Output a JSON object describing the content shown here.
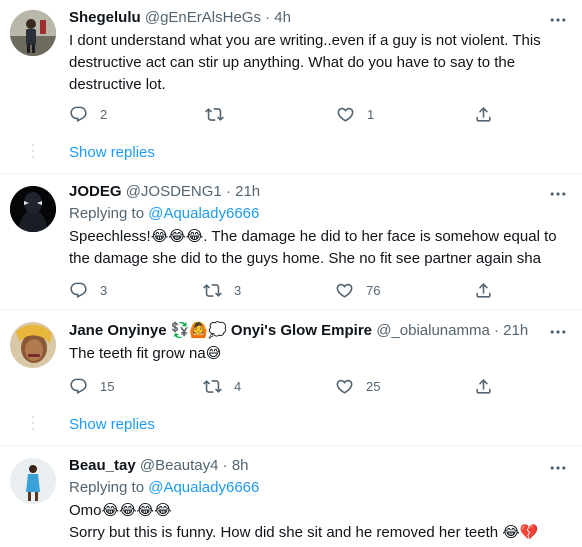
{
  "tweets": [
    {
      "name": "Shegelulu",
      "handle": "@gEnErAlsHeGs",
      "time": "· 4h",
      "text": "I dont understand what you are writing..even if a guy is not violent. This destructive act can stir up anything. What do you have to say to the destructive lot.",
      "replies": "2",
      "retweets": "",
      "likes": "1"
    },
    {
      "name": "JODEG",
      "handle": "@JOSDENG1",
      "time": "· 21h",
      "replying_label": "Replying to",
      "replying_handle": "@Aqualady6666",
      "text": "Speechless!😂😂😂.  The damage he did to her face is somehow equal to the damage she did to the guys home. She no fit see partner again sha",
      "replies": "3",
      "retweets": "3",
      "likes": "76"
    },
    {
      "name": "Jane Onyinye 💱🙆💭 Onyi's Glow Empire",
      "handle": "@_obialunamma",
      "time": "· 21h",
      "text": "The teeth fit grow na😅",
      "replies": "15",
      "retweets": "4",
      "likes": "25"
    },
    {
      "name": "Beau_tay",
      "handle": "@Beautay4",
      "time": "· 8h",
      "replying_label": "Replying to",
      "replying_handle": "@Aqualady6666",
      "text_line1": "Omo😂😂😂😂",
      "text_line2": "Sorry but this is funny. How did she sit and he removed her teeth 😂💔"
    }
  ],
  "show_replies": "Show replies",
  "colors": {
    "accent": "#1d9bf0",
    "muted": "#536471",
    "divider": "#eff3f4"
  },
  "icons": [
    "reply-icon",
    "retweet-icon",
    "like-icon",
    "share-icon",
    "more-icon"
  ]
}
